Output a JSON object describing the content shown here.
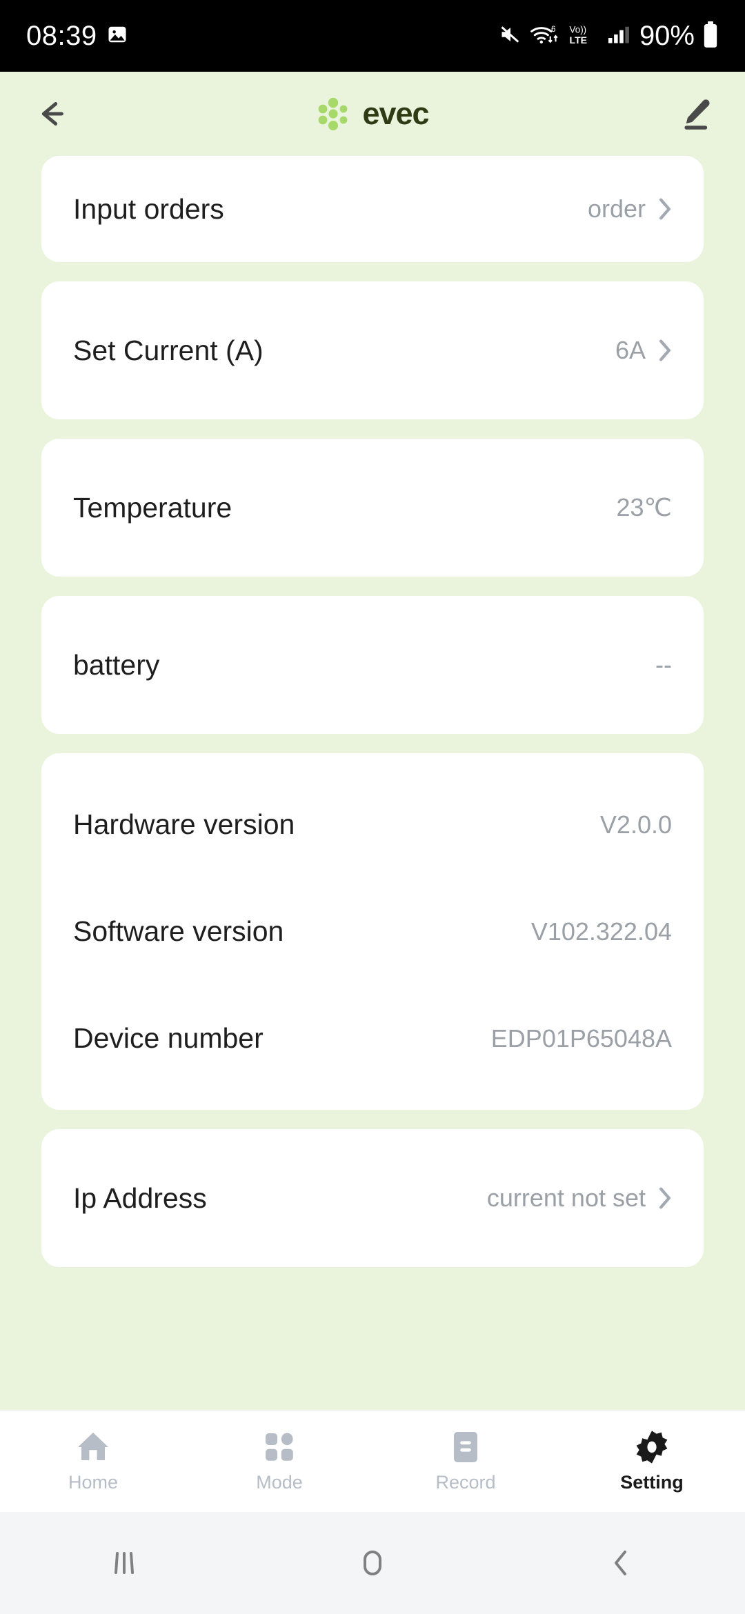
{
  "status_bar": {
    "time": "08:39",
    "battery_percent": "90%",
    "network_label": "LTE",
    "volte_label": "Vo))",
    "wifi_generation": "6",
    "icons": [
      "screenshot-icon",
      "mute-icon",
      "wifi-icon",
      "volte-icon",
      "signal-icon",
      "battery-icon"
    ]
  },
  "header": {
    "back_label": "Back",
    "brand": "evec",
    "edit_label": "Edit",
    "brand_dot_color": "#A6D96A",
    "brand_text_color": "#2E3B14"
  },
  "cards": [
    {
      "rows": [
        {
          "label": "Input orders",
          "value": "order",
          "chevron": true
        }
      ]
    },
    {
      "rows": [
        {
          "label": "Set Current (A)",
          "value": "6A",
          "chevron": true
        }
      ]
    },
    {
      "rows": [
        {
          "label": "Temperature",
          "value": "23℃",
          "chevron": false
        }
      ]
    },
    {
      "rows": [
        {
          "label": "battery",
          "value": "--",
          "chevron": false
        }
      ]
    },
    {
      "rows": [
        {
          "label": "Hardware version",
          "value": "V2.0.0",
          "chevron": false
        },
        {
          "label": "Software version",
          "value": "V102.322.04",
          "chevron": false
        },
        {
          "label": "Device number",
          "value": "EDP01P65048A",
          "chevron": false
        }
      ]
    },
    {
      "rows": [
        {
          "label": "Ip Address",
          "value": "current not set",
          "chevron": true
        }
      ]
    }
  ],
  "tabbar": {
    "items": [
      {
        "label": "Home",
        "icon": "home-icon",
        "active": false
      },
      {
        "label": "Mode",
        "icon": "grid-icon",
        "active": false
      },
      {
        "label": "Record",
        "icon": "document-icon",
        "active": false
      },
      {
        "label": "Setting",
        "icon": "gear-icon",
        "active": true
      }
    ],
    "inactive_color": "#B6BDC6",
    "active_color": "#1A1A1A"
  },
  "navbar": {
    "recents_label": "Recents",
    "home_label": "Home",
    "back_label": "Back"
  },
  "theme": {
    "page_background": "#EAF4DC",
    "card_background": "#FFFFFF",
    "label_color": "#1E1E1E",
    "value_color": "#9AA0A6"
  }
}
